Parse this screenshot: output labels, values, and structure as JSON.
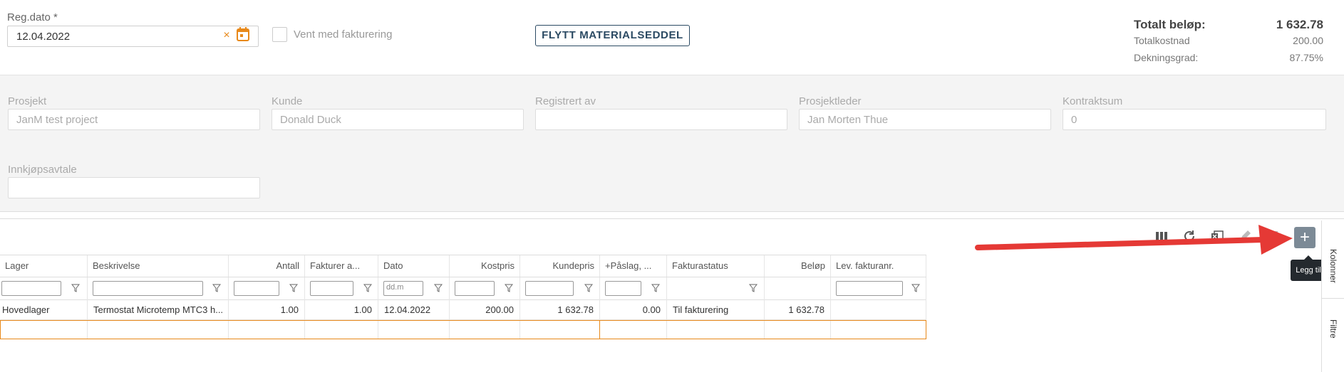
{
  "header": {
    "reg_dato_label": "Reg.dato *",
    "reg_dato_value": "12.04.2022",
    "clear_glyph": "×",
    "vent_label": "Vent med fakturering",
    "flytt_button": "FLYTT MATERIALSEDDEL"
  },
  "summary": {
    "rows": [
      {
        "label": "Totalt beløp:",
        "value": "1 632.78"
      },
      {
        "label": "Totalkostnad",
        "value": "200.00"
      },
      {
        "label": "Dekningsgrad:",
        "value": "87.75%"
      }
    ]
  },
  "info": {
    "prosjekt_label": "Prosjekt",
    "prosjekt_value": "JanM test project",
    "kunde_label": "Kunde",
    "kunde_value": "Donald Duck",
    "registrert_label": "Registrert av",
    "registrert_value": "",
    "prosjektleder_label": "Prosjektleder",
    "prosjektleder_value": "Jan Morten Thue",
    "kontraktsum_label": "Kontraktsum",
    "kontraktsum_value": "0",
    "innkjop_label": "Innkjøpsavtale",
    "innkjop_value": ""
  },
  "toolbar": {
    "icons": [
      "columns-icon",
      "refresh-icon",
      "excel-export-icon",
      "edit-icon",
      "delete-icon"
    ],
    "add_glyph": "+",
    "tooltip": "Legg til"
  },
  "side_panel": {
    "kolonner": "Kolonner",
    "filtre": "Filtre"
  },
  "grid": {
    "columns": [
      "Lager",
      "Beskrivelse",
      "Antall",
      "Fakturer a...",
      "Dato",
      "Kostpris",
      "Kundepris",
      "+Påslag, ...",
      "Fakturastatus",
      "Beløp",
      "Lev. fakturanr."
    ],
    "date_filter_placeholder": "dd.m",
    "row": [
      "Hovedlager",
      "Termostat Microtemp MTC3 h...",
      "1.00",
      "1.00",
      "12.04.2022",
      "200.00",
      "1 632.78",
      "0.00",
      "Til fakturering",
      "1 632.78",
      ""
    ]
  },
  "colors": {
    "accent_orange": "#e8891a",
    "button_navy": "#2b4a63",
    "arrow_red": "#e53935"
  }
}
